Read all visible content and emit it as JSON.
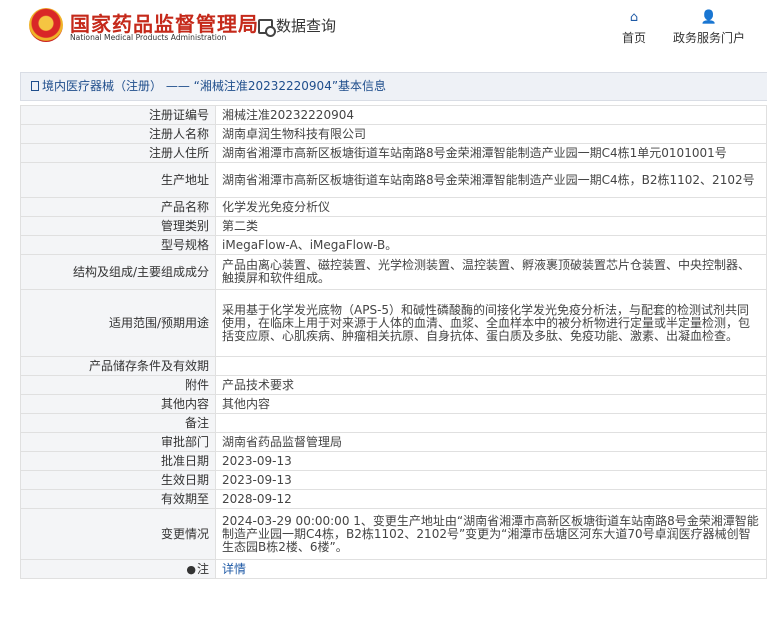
{
  "header": {
    "brand_cn": "国家药品监督管理局",
    "brand_en": "National Medical Products Administration",
    "query_label": "数据查询",
    "nav_home": "首页",
    "nav_gov": "政务服务门户"
  },
  "panel": {
    "title": "境内医疗器械（注册） —— “湘械注准20232220904”基本信息"
  },
  "rows": [
    {
      "label": "注册证编号",
      "value": "湘械注准20232220904"
    },
    {
      "label": "注册人名称",
      "value": "湖南卓润生物科技有限公司"
    },
    {
      "label": "注册人住所",
      "value": "湖南省湘潭市高新区板塘街道车站南路8号金荣湘潭智能制造产业园一期C4栋1单元0101001号"
    },
    {
      "label": "生产地址",
      "value": "湖南省湘潭市高新区板塘街道车站南路8号金荣湘潭智能制造产业园一期C4栋，B2栋1102、2102号"
    },
    {
      "label": "产品名称",
      "value": "化学发光免疫分析仪"
    },
    {
      "label": "管理类别",
      "value": "第二类"
    },
    {
      "label": "型号规格",
      "value": "iMegaFlow-A、iMegaFlow-B。"
    },
    {
      "label": "结构及组成/主要组成成分",
      "value": "产品由离心装置、磁控装置、光学检测装置、温控装置、孵液裹顶破装置芯片仓装置、中央控制器、触摸屏和软件组成。"
    },
    {
      "label": "适用范围/预期用途",
      "value": "采用基于化学发光底物（APS-5）和碱性磷酸酶的间接化学发光免疫分析法，与配套的检测试剂共同使用，在临床上用于对来源于人体的血清、血浆、全血样本中的被分析物进行定量或半定量检测，包括变应原、心肌疾病、肿瘤相关抗原、自身抗体、蛋白质及多肽、免疫功能、激素、出凝血检查。"
    },
    {
      "label": "产品储存条件及有效期",
      "value": ""
    },
    {
      "label": "附件",
      "value": "产品技术要求"
    },
    {
      "label": "其他内容",
      "value": "其他内容"
    },
    {
      "label": "备注",
      "value": ""
    },
    {
      "label": "审批部门",
      "value": "湖南省药品监督管理局"
    },
    {
      "label": "批准日期",
      "value": "2023-09-13"
    },
    {
      "label": "生效日期",
      "value": "2023-09-13"
    },
    {
      "label": "有效期至",
      "value": "2028-09-12"
    },
    {
      "label": "变更情况",
      "value": "2024-03-29 00:00:00 1、变更生产地址由“湖南省湘潭市高新区板塘街道车站南路8号金荣湘潭智能制造产业园一期C4栋，B2栋1102、2102号”变更为“湘潭市岳塘区河东大道70号卓润医疗器械创智生态园B栋2楼、6楼”。"
    }
  ],
  "footer_row": {
    "label": "注",
    "value": "详情"
  }
}
